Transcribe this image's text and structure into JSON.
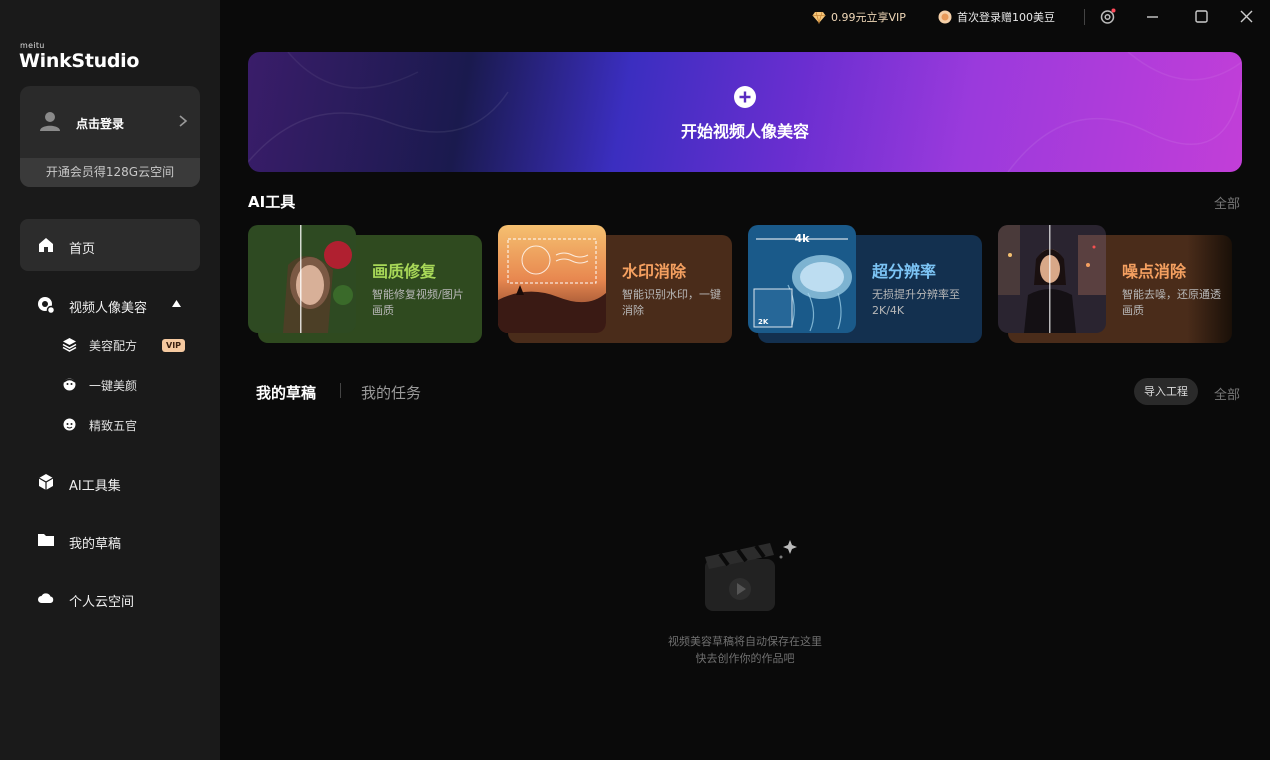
{
  "sidebar": {
    "brand_small": "meitu",
    "brand": "WinkStudio",
    "login": {
      "label": "点击登录",
      "promo": "开通会员得128G云空间"
    },
    "nav": [
      {
        "label": "首页",
        "icon": "home-icon"
      },
      {
        "label": "视频人像美容",
        "icon": "video-beauty-icon"
      },
      {
        "label": "AI工具集",
        "icon": "ai-toolbox-icon"
      },
      {
        "label": "我的草稿",
        "icon": "folder-icon"
      },
      {
        "label": "个人云空间",
        "icon": "cloud-icon"
      }
    ],
    "sub_nav": [
      {
        "label": "美容配方",
        "icon": "layers-icon",
        "badge": "VIP"
      },
      {
        "label": "一键美颜",
        "icon": "face-beauty-icon"
      },
      {
        "label": "精致五官",
        "icon": "face-features-icon"
      }
    ]
  },
  "titlebar": {
    "vip_promo": "0.99元立享VIP",
    "login_gift": "首次登录赠100美豆"
  },
  "banner": {
    "label": "开始视频人像美容"
  },
  "ai_tools": {
    "title": "AI工具",
    "see_all": "全部",
    "items": [
      {
        "title": "画质修复",
        "desc": "智能修复视频/图片画质",
        "color": "#a8d858",
        "bg": "#2f4a1f"
      },
      {
        "title": "水印消除",
        "desc": "智能识别水印，一键消除",
        "color": "#f5a060",
        "bg": "#4a2c1a"
      },
      {
        "title": "超分辨率",
        "desc": "无损提升分辨率至2K/4K",
        "color": "#7cc4f5",
        "bg": "#13304f"
      },
      {
        "title": "噪点消除",
        "desc": "智能去噪，还原通透画质",
        "color": "#f5a060",
        "bg": "#4a2c1a"
      }
    ]
  },
  "drafts": {
    "tab_drafts": "我的草稿",
    "tab_tasks": "我的任务",
    "import_label": "导入工程",
    "see_all": "全部",
    "empty_line1": "视频美容草稿将自动保存在这里",
    "empty_line2": "快去创作你的作品吧"
  }
}
